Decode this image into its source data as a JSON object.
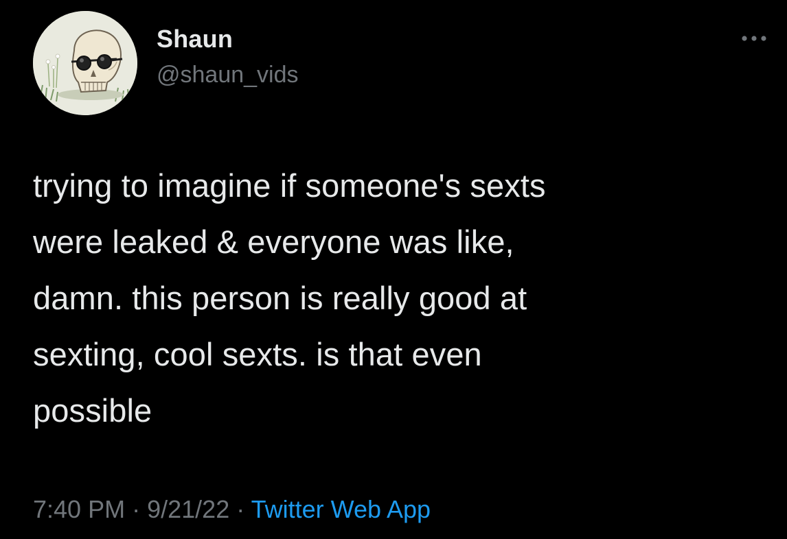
{
  "author": {
    "display_name": "Shaun",
    "handle": "@shaun_vids",
    "avatar": "skull-with-sunglasses-avatar"
  },
  "more_icon": "more-horizontal-icon",
  "tweet": {
    "lines": [
      "trying to imagine if someone's sexts",
      "were leaked & everyone was like,",
      "damn. this person is really good at",
      "sexting, cool sexts. is that even",
      "possible"
    ]
  },
  "meta": {
    "time": "7:40 PM",
    "separator1": "·",
    "date": "9/21/22",
    "separator2": "·",
    "source": "Twitter Web App"
  },
  "colors": {
    "background": "#000000",
    "text_primary": "#e7e9ea",
    "text_secondary": "#71767b",
    "link": "#1d9bf0"
  }
}
